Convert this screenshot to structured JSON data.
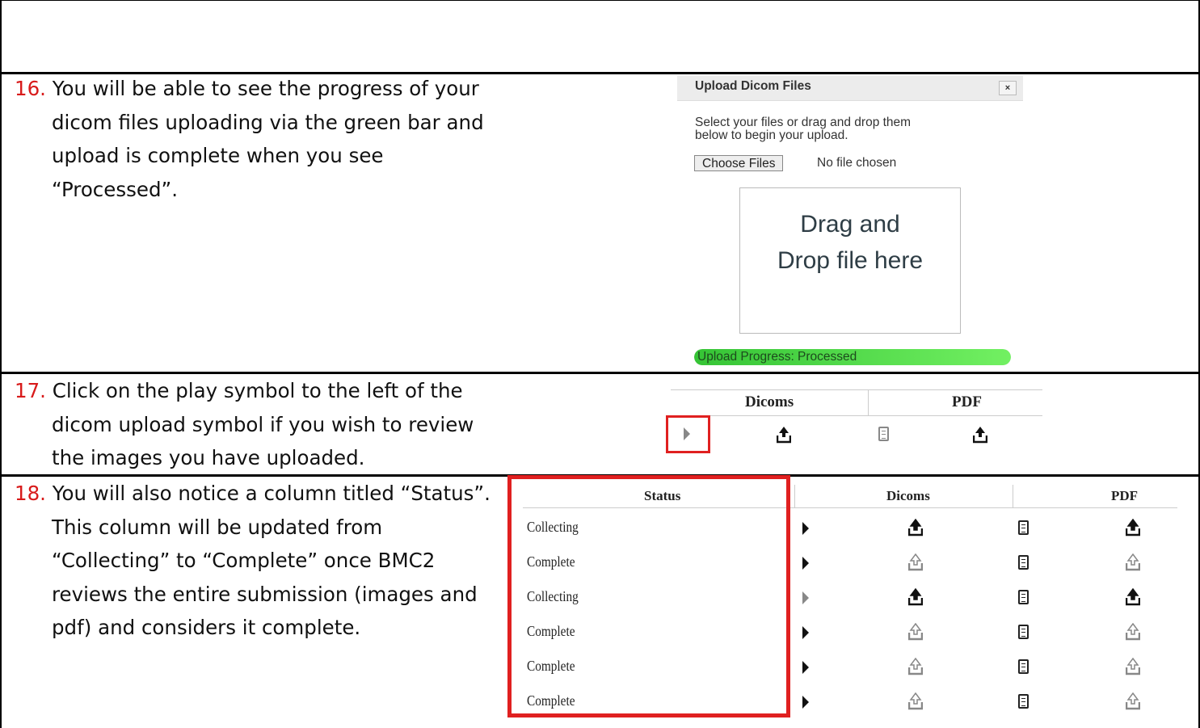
{
  "steps": [
    {
      "num": "16.",
      "lines": [
        "You will be able to see the progress of your",
        "dicom files uploading via the green bar and",
        "upload is complete when you see",
        "“Processed”."
      ]
    },
    {
      "num": "17.",
      "lines": [
        "Click on the play symbol to the left of the",
        "dicom upload symbol if you wish to review",
        "the images you have uploaded."
      ]
    },
    {
      "num": "18.",
      "lines": [
        "You will also notice a column titled “Status”.",
        "This column will be updated from",
        "“Collecting” to “Complete” once BMC2",
        "reviews the entire submission (images and",
        "pdf) and considers it complete."
      ]
    }
  ],
  "upload_dialog": {
    "title": "Upload Dicom Files",
    "close_label": "×",
    "instructions_line1": "Select your files or drag and drop them",
    "instructions_line2": "below to begin your upload.",
    "choose_button": "Choose Files",
    "file_status": "No file chosen",
    "drop_line1": "Drag and",
    "drop_line2": "Drop file here",
    "progress_label": "Upload Progress: Processed",
    "progress_fraction": 1.0
  },
  "table17": {
    "headers": [
      "Dicoms",
      "PDF"
    ],
    "highlight_color": "#e02020"
  },
  "table18": {
    "headers": [
      "Status",
      "Dicoms",
      "PDF"
    ],
    "rows": [
      {
        "status": "Collecting",
        "play": "dark",
        "upload": "dark"
      },
      {
        "status": "Complete",
        "play": "dark",
        "upload": "grey"
      },
      {
        "status": "Collecting",
        "play": "grey",
        "upload": "dark"
      },
      {
        "status": "Complete",
        "play": "dark",
        "upload": "grey"
      },
      {
        "status": "Complete",
        "play": "dark",
        "upload": "grey"
      },
      {
        "status": "Complete",
        "play": "dark",
        "upload": "grey"
      }
    ]
  },
  "colors": {
    "step_number": "#d81b1b",
    "progress_green": "#5fe24f",
    "highlight_red": "#e02020"
  },
  "icons": [
    "play-icon",
    "upload-icon",
    "document-icon",
    "close-icon"
  ]
}
